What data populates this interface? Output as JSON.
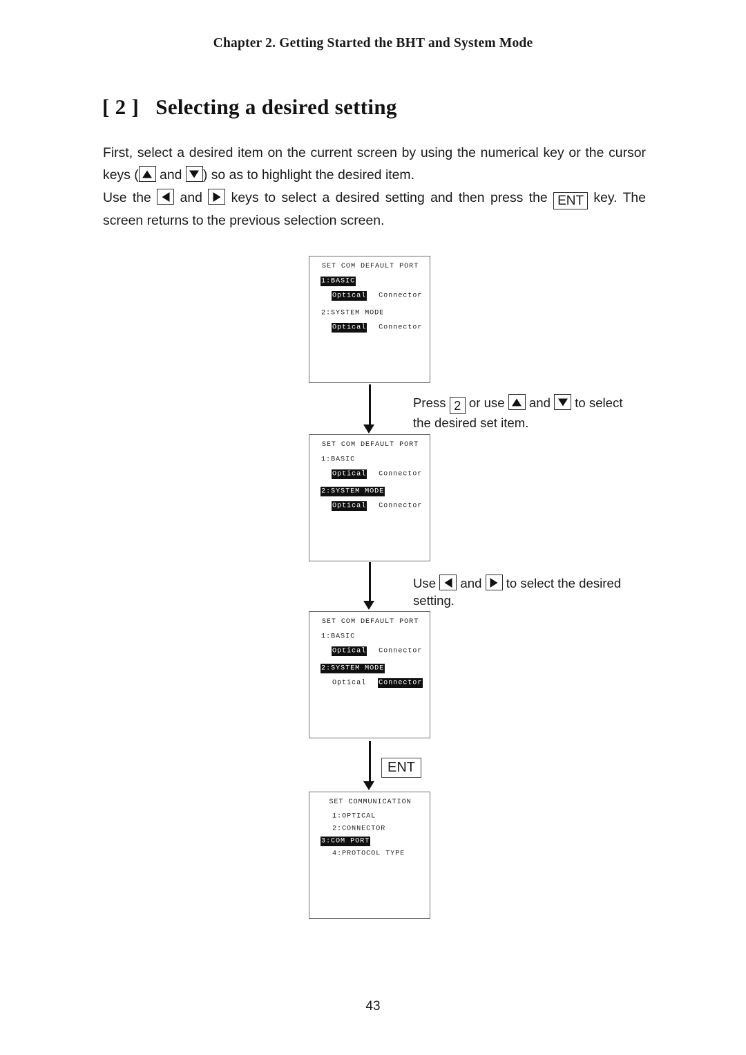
{
  "header": {
    "chapter": "Chapter 2.  Getting Started the BHT and System Mode"
  },
  "title": {
    "number": "[ 2 ]",
    "text": "Selecting a desired setting",
    "full": "[ 2 ]   Selecting a desired setting"
  },
  "paragraphs": {
    "p1": {
      "part1": "First, select a desired item on the current screen by using the numerical key or the cursor keys (",
      "part2": " and ",
      "part3": ") so as to highlight the desired item.",
      "key_up": "up-arrow-key",
      "key_down": "down-arrow-key"
    },
    "p2": {
      "part1": "Use the ",
      "part2": " and ",
      "part3": " keys to select a desired setting and then press the ",
      "ent_label": "ENT",
      "part4": " key.  The screen returns to the previous selection screen.",
      "key_left": "left-arrow-key",
      "key_right": "right-arrow-key"
    }
  },
  "screens": [
    {
      "id": "screen-1",
      "title": "SET COM DEFAULT PORT",
      "rows": [
        {
          "text": "1:BASIC",
          "highlight": true
        },
        {
          "value_a": "Optical",
          "value_a_highlight": true,
          "value_b": "Connector",
          "value_b_highlight": false
        },
        {
          "text": "2:SYSTEM MODE",
          "highlight": false
        },
        {
          "value_a": "Optical",
          "value_a_highlight": true,
          "value_b": "Connector",
          "value_b_highlight": false
        }
      ]
    },
    {
      "id": "screen-2",
      "title": "SET COM DEFAULT PORT",
      "rows": [
        {
          "text": "1:BASIC",
          "highlight": false
        },
        {
          "value_a": "Optical",
          "value_a_highlight": true,
          "value_b": "Connector",
          "value_b_highlight": false
        },
        {
          "text": "2:SYSTEM MODE",
          "highlight": true
        },
        {
          "value_a": "Optical",
          "value_a_highlight": true,
          "value_b": "Connector",
          "value_b_highlight": false
        }
      ]
    },
    {
      "id": "screen-3",
      "title": "SET COM DEFAULT PORT",
      "rows": [
        {
          "text": "1:BASIC",
          "highlight": false
        },
        {
          "value_a": "Optical",
          "value_a_highlight": true,
          "value_b": "Connector",
          "value_b_highlight": false
        },
        {
          "text": "2:SYSTEM MODE",
          "highlight": true
        },
        {
          "value_a": "Optical",
          "value_a_highlight": false,
          "value_b": "Connector",
          "value_b_highlight": true
        }
      ]
    },
    {
      "id": "screen-4",
      "title": "SET COMMUNICATION",
      "menu": [
        {
          "text": "1:OPTICAL",
          "highlight": false
        },
        {
          "text": "2:CONNECTOR",
          "highlight": false
        },
        {
          "text": "3:COM PORT",
          "highlight": true
        },
        {
          "text": "4:PROTOCOL TYPE",
          "highlight": false
        }
      ]
    }
  ],
  "annotations": {
    "step1": {
      "part1": "Press ",
      "key_num": "2",
      "part2": " or use ",
      "part3": " and ",
      "part4": " to select",
      "line2": "the desired set item."
    },
    "step2": {
      "part1": "Use ",
      "part2": " and ",
      "part3": " to select the desired",
      "line2": "setting."
    },
    "ent_key": "ENT"
  },
  "footer": {
    "page_number": "43"
  },
  "colors": {
    "text": "#1a1a1a",
    "highlight_bg": "#101010",
    "highlight_fg": "#ffffff",
    "lcd_border": "#6f6f6f",
    "arrow": "#111111"
  }
}
